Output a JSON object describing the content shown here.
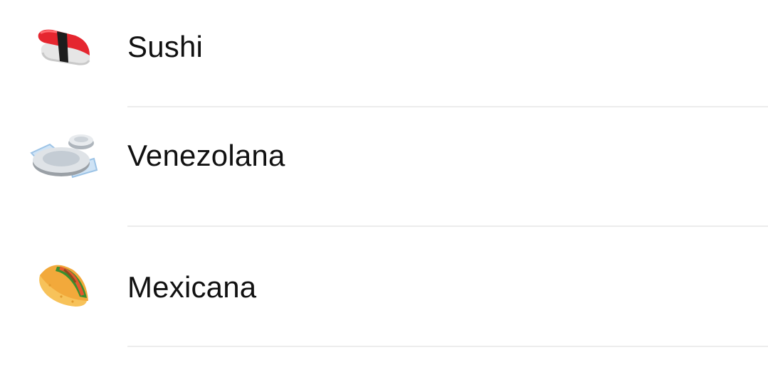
{
  "cuisines": [
    {
      "label": "Sushi",
      "icon": "sushi-icon"
    },
    {
      "label": "Venezolana",
      "icon": "plate-icon"
    },
    {
      "label": "Mexicana",
      "icon": "taco-icon"
    }
  ],
  "colors": {
    "text": "#111111",
    "divider": "#ececec",
    "background": "#ffffff"
  }
}
